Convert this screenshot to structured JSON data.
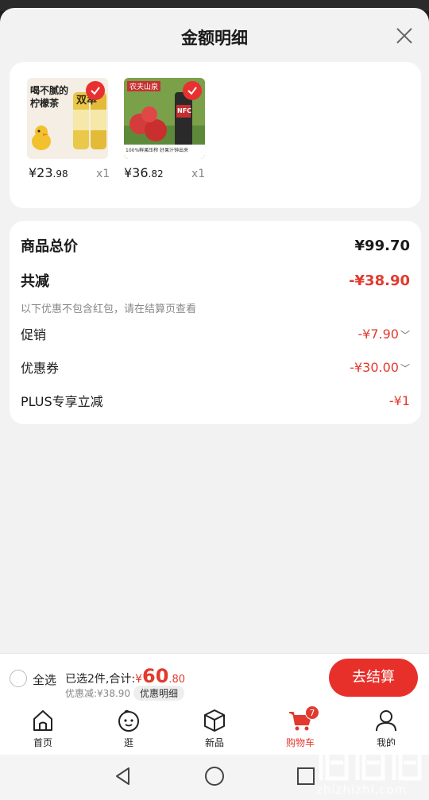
{
  "sheet": {
    "title": "金额明细"
  },
  "products": [
    {
      "price_main": "¥23",
      "price_decimal": ".98",
      "qty": "x1",
      "thumb_text_1": "喝不腻的",
      "thumb_text_2": "柠檬茶",
      "thumb_text_3": "双萃"
    },
    {
      "price_main": "¥36",
      "price_decimal": ".82",
      "qty": "x1",
      "thumb_text_1": "农夫山泉",
      "thumb_text_2": "NFC",
      "thumb_text_3": "100%鲜果压榨 好果汁钟出来"
    }
  ],
  "summary": {
    "total_label": "商品总价",
    "total_value": "¥99.70",
    "discount_label": "共减",
    "discount_value": "-¥38.90",
    "note": "以下优惠不包含红包，请在结算页查看",
    "promo_label": "促销",
    "promo_value": "-¥7.90",
    "coupon_label": "优惠券",
    "coupon_value": "-¥30.00",
    "plus_label": "PLUS专享立减",
    "plus_value": "-¥1"
  },
  "bottom": {
    "select_all": "全选",
    "selected_text": "已选2件,合计:",
    "amount_symbol": "¥",
    "amount_main": "60",
    "amount_decimal": ".80",
    "discount_text": "优惠减:¥38.90",
    "detail_label": "优惠明细",
    "checkout_label": "去结算"
  },
  "tabs": [
    {
      "label": "首页",
      "icon": "home-icon"
    },
    {
      "label": "逛",
      "icon": "browse-icon"
    },
    {
      "label": "新品",
      "icon": "new-product-icon"
    },
    {
      "label": "购物车",
      "icon": "cart-icon",
      "badge": "7"
    },
    {
      "label": "我的",
      "icon": "profile-icon"
    }
  ],
  "watermark": {
    "text": "zhizhizhi.com"
  },
  "colors": {
    "accent": "#e23a2e",
    "checkout_bg": "#e8302b"
  }
}
